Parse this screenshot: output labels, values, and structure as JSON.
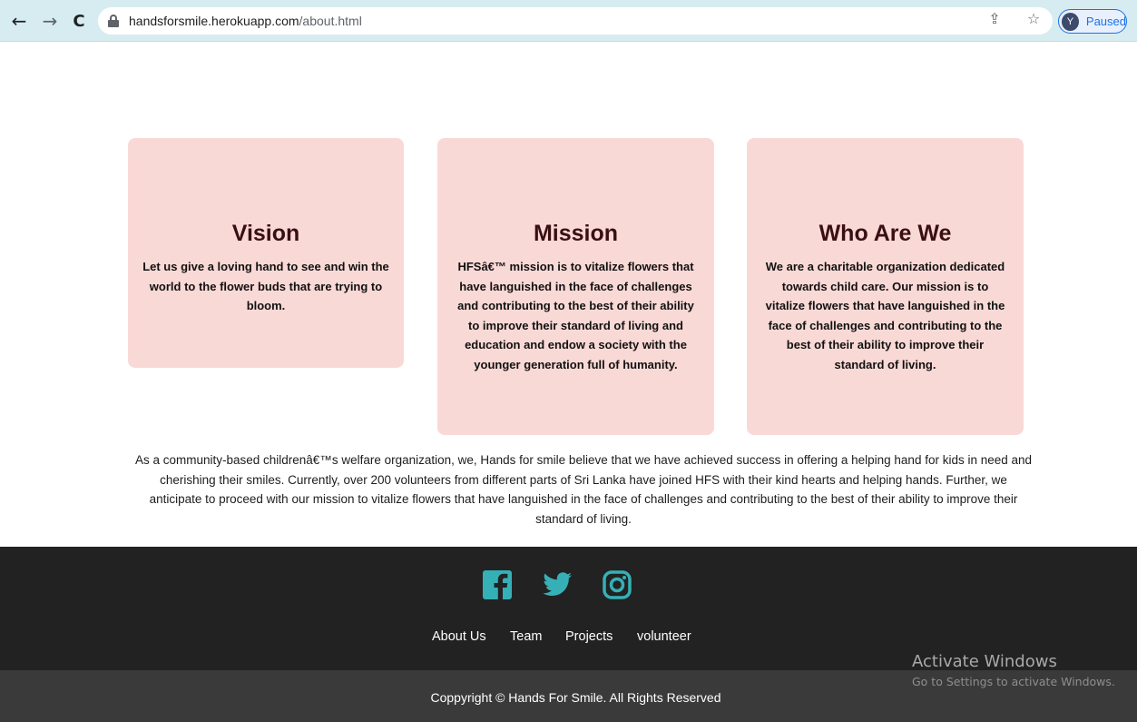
{
  "browser": {
    "url_host": "handsforsmile.herokuapp.com",
    "url_path": "/about.html",
    "profile_initial": "Y",
    "profile_status": "Paused",
    "back_glyph": "←",
    "forward_glyph": "→",
    "reload_glyph": "C",
    "share_glyph": "⇪",
    "star_glyph": "☆"
  },
  "cards": [
    {
      "title": "Vision",
      "body": "Let us give a loving hand to see and win the world to the flower buds that are trying to bloom."
    },
    {
      "title": "Mission",
      "body": "HFSâ€™ mission is to vitalize flowers that have languished in the face of challenges and contributing to the best of their ability to improve their standard of living and education and endow a society with the younger generation full of humanity."
    },
    {
      "title": "Who Are We",
      "body": "We are a charitable organization dedicated towards child care. Our mission is to vitalize flowers that have languished in the face of challenges and contributing to the best of their ability to improve their standard of living."
    }
  ],
  "about_text": "As a community-based childrenâ€™s welfare organization, we, Hands for smile believe that we have achieved success in offering a helping hand for kids in need and cherishing their smiles. Currently, over 200 volunteers from different parts of Sri Lanka have joined HFS with their kind hearts and helping hands. Further, we anticipate to proceed with our mission to vitalize flowers that have languished in the face of challenges and contributing to the best of their ability to improve their standard of living.",
  "footer": {
    "social": [
      "facebook-icon",
      "twitter-icon",
      "instagram-icon"
    ],
    "links": [
      "About Us",
      "Team",
      "Projects",
      "volunteer"
    ],
    "copyright": "Coppyright © Hands For Smile. All Rights Reserved",
    "icon_color": "#35b0b6"
  },
  "watermark": {
    "title": "Activate Windows",
    "subtitle": "Go to Settings to activate Windows."
  },
  "colors": {
    "card_bg": "#f9d9d6",
    "card_title": "#3a0f14",
    "footer_top": "#222222",
    "footer_bottom": "#3a3a3a"
  }
}
